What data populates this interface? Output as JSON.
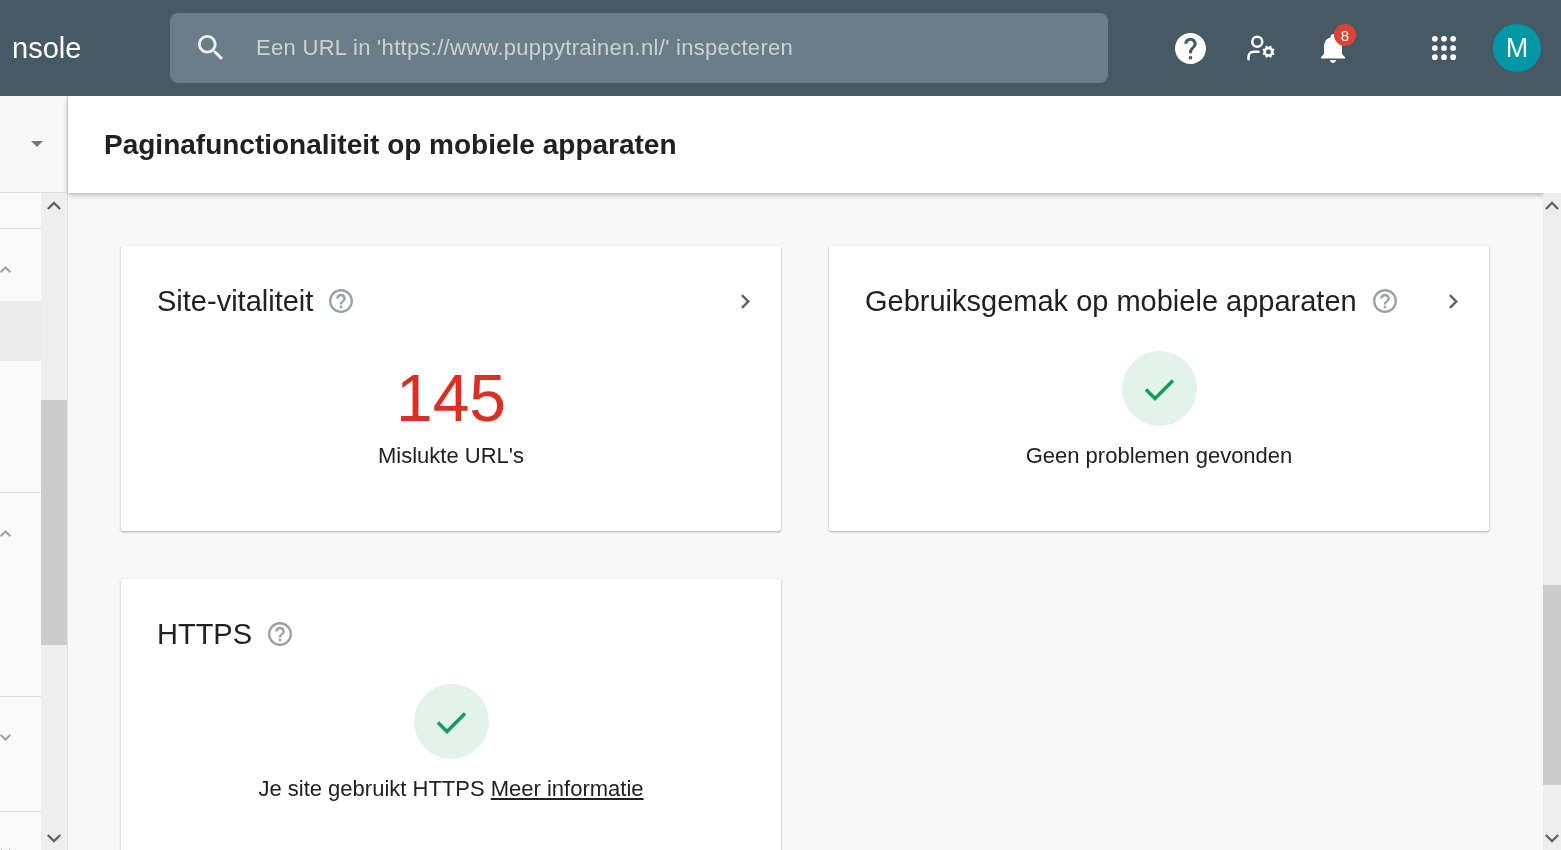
{
  "app_bar": {
    "logo_text": "nsole",
    "search": {
      "placeholder": "Een URL in 'https://www.puppytrainen.nl/' inspecteren"
    },
    "notification_badge": "8",
    "avatar_initial": "M"
  },
  "sidebar": {
    "sections": [
      {
        "expanded": true,
        "rows": [
          {
            "selected": true
          }
        ]
      },
      {
        "expanded": true
      },
      {
        "expanded": false
      },
      {
        "expanded": false
      }
    ]
  },
  "page_title": "Paginafunctionaliteit op mobiele apparaten",
  "cards": [
    {
      "kind": "count",
      "title": "Site-vitaliteit",
      "has_details": true,
      "value": "145",
      "caption": "Mislukte URL's"
    },
    {
      "kind": "status",
      "title": "Gebruiksgemak op mobiele apparaten",
      "has_details": true,
      "caption": "Geen problemen gevonden"
    },
    {
      "kind": "status",
      "title": "HTTPS",
      "has_details": false,
      "caption": "Je site gebruikt HTTPS",
      "link": "Meer informatie"
    }
  ]
}
